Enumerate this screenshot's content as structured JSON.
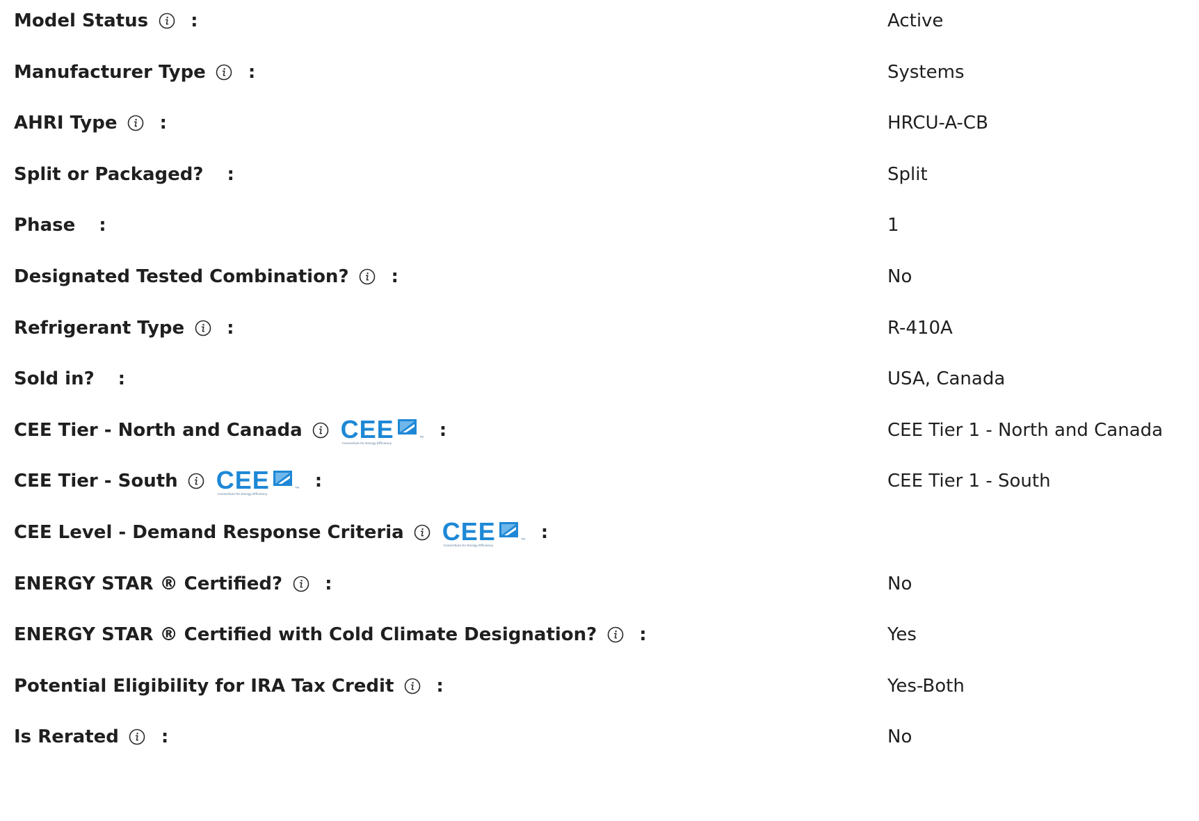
{
  "rows": [
    {
      "label": "Model Status",
      "value": "Active",
      "info": true,
      "cee": false
    },
    {
      "label": "Manufacturer Type",
      "value": "Systems",
      "info": true,
      "cee": false
    },
    {
      "label": "AHRI Type",
      "value": "HRCU-A-CB",
      "info": true,
      "cee": false
    },
    {
      "label": "Split or Packaged?",
      "value": "Split",
      "info": false,
      "cee": false
    },
    {
      "label": "Phase",
      "value": "1",
      "info": false,
      "cee": false
    },
    {
      "label": "Designated Tested Combination?",
      "value": "No",
      "info": true,
      "cee": false
    },
    {
      "label": "Refrigerant Type",
      "value": "R-410A",
      "info": true,
      "cee": false
    },
    {
      "label": "Sold in?",
      "value": "USA, Canada",
      "info": false,
      "cee": false
    },
    {
      "label": "CEE Tier - North and Canada",
      "value": "CEE Tier 1 - North and Canada",
      "info": true,
      "cee": true
    },
    {
      "label": "CEE Tier - South",
      "value": "CEE Tier 1 - South",
      "info": true,
      "cee": true
    },
    {
      "label": "CEE Level - Demand Response Criteria",
      "value": "",
      "info": true,
      "cee": true
    },
    {
      "label": "ENERGY STAR ® Certified?",
      "value": "No",
      "info": true,
      "cee": false
    },
    {
      "label": "ENERGY STAR ® Certified with Cold Climate Designation?",
      "value": "Yes",
      "info": true,
      "cee": false
    },
    {
      "label": "Potential Eligibility for IRA Tax Credit",
      "value": "Yes-Both",
      "info": true,
      "cee": false
    },
    {
      "label": "Is Rerated",
      "value": "No",
      "info": true,
      "cee": false
    }
  ],
  "separator": ":",
  "cee_logo": {
    "text": "CEE",
    "tm": "™",
    "tagline": "Consortium for Energy Efficiency",
    "color": "#1e88d6"
  },
  "icons": {
    "info": "info-circle-icon"
  }
}
